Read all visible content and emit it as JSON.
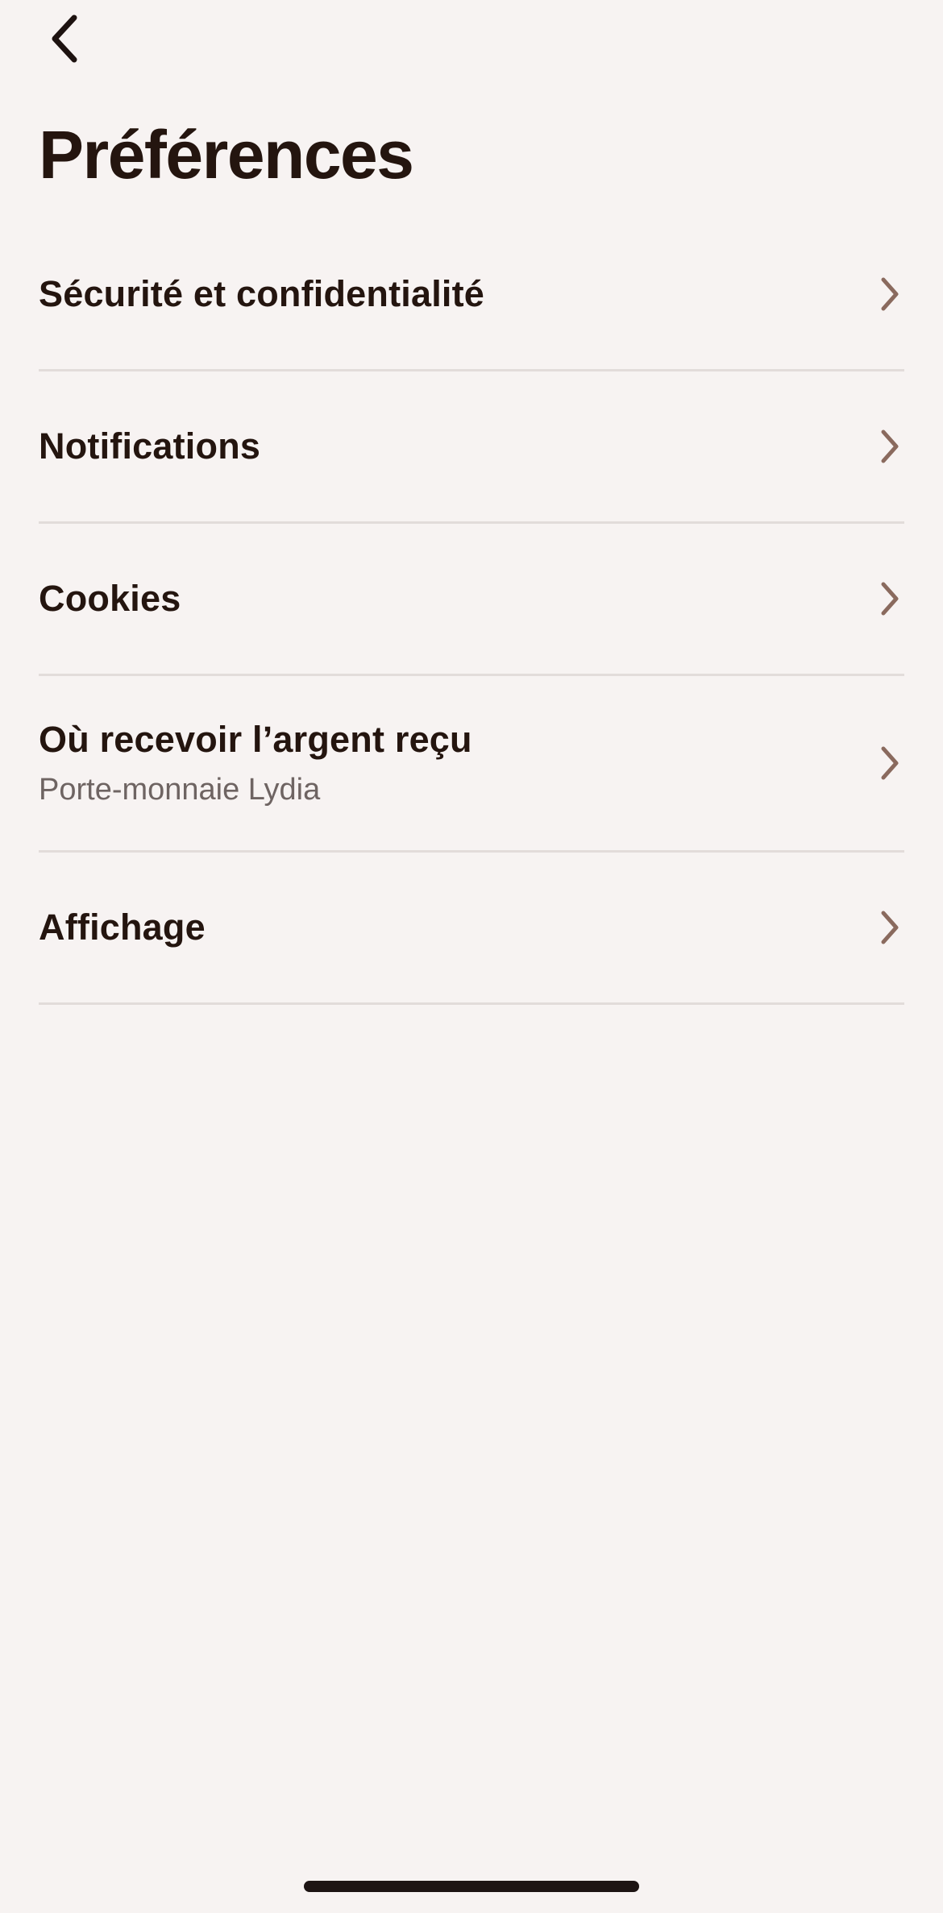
{
  "header": {
    "back_icon": "chevron-left-icon",
    "title": "Préférences"
  },
  "menu": {
    "items": [
      {
        "label": "Sécurité et confidentialité",
        "icon": "chevron-right-icon"
      },
      {
        "label": "Notifications",
        "icon": "chevron-right-icon"
      },
      {
        "label": "Cookies",
        "icon": "chevron-right-icon"
      },
      {
        "label": "Où recevoir l’argent reçu",
        "sublabel": "Porte-monnaie Lydia",
        "icon": "chevron-right-icon"
      },
      {
        "label": "Affichage",
        "icon": "chevron-right-icon"
      }
    ]
  },
  "colors": {
    "background": "#f7f3f2",
    "text": "#24150f",
    "secondary_text": "#6e6462",
    "chevron": "#8a6a5e",
    "divider": "#e2dcda",
    "home_indicator": "#1d1413"
  }
}
